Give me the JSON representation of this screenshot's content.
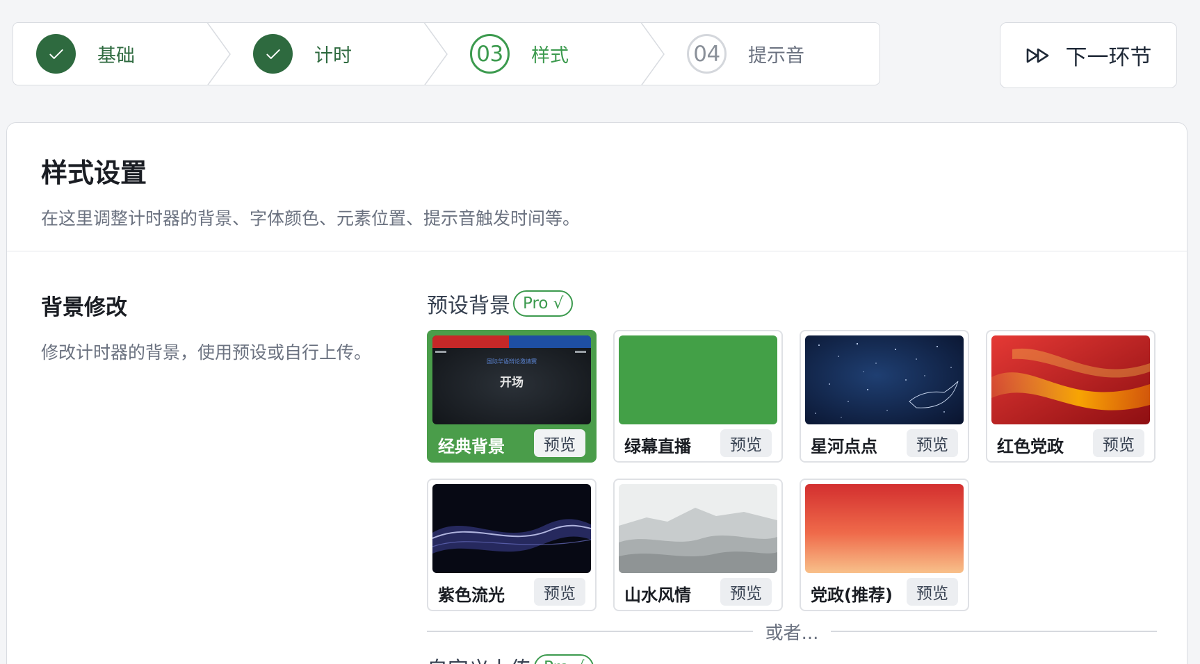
{
  "stepper": {
    "steps": [
      {
        "label": "基础",
        "status": "done",
        "marker": "check-icon"
      },
      {
        "label": "计时",
        "status": "done",
        "marker": "check-icon"
      },
      {
        "label": "样式",
        "status": "current",
        "number": "03"
      },
      {
        "label": "提示音",
        "status": "todo",
        "number": "04"
      }
    ]
  },
  "next_button": {
    "label": "下一环节",
    "icon": "fast-forward-icon"
  },
  "style_panel": {
    "title": "样式设置",
    "description": "在这里调整计时器的背景、字体颜色、元素位置、提示音触发时间等。"
  },
  "background_section": {
    "title": "背景修改",
    "description": "修改计时器的背景，使用预设或自行上传。",
    "preset_label": "预设背景",
    "pro_badge": "Pro √",
    "presets": [
      {
        "name": "经典背景",
        "selected": true,
        "thumb_title": "开场",
        "thumb_subtitle": "国际华语辩论邀请赛"
      },
      {
        "name": "绿幕直播",
        "selected": false
      },
      {
        "name": "星河点点",
        "selected": false
      },
      {
        "name": "红色党政",
        "selected": false
      },
      {
        "name": "紫色流光",
        "selected": false
      },
      {
        "name": "山水风情",
        "selected": false
      },
      {
        "name": "党政(推荐)",
        "selected": false
      }
    ],
    "preview_label": "预览",
    "or_divider": "或者...",
    "custom_upload_label": "自定义上传",
    "custom_upload_badge": "Pro √"
  },
  "colors": {
    "accent_green": "#3c9a4e",
    "done_green": "#2e6a3f",
    "selected_tile": "#4a9d4a",
    "green_screen": "#43a047"
  }
}
